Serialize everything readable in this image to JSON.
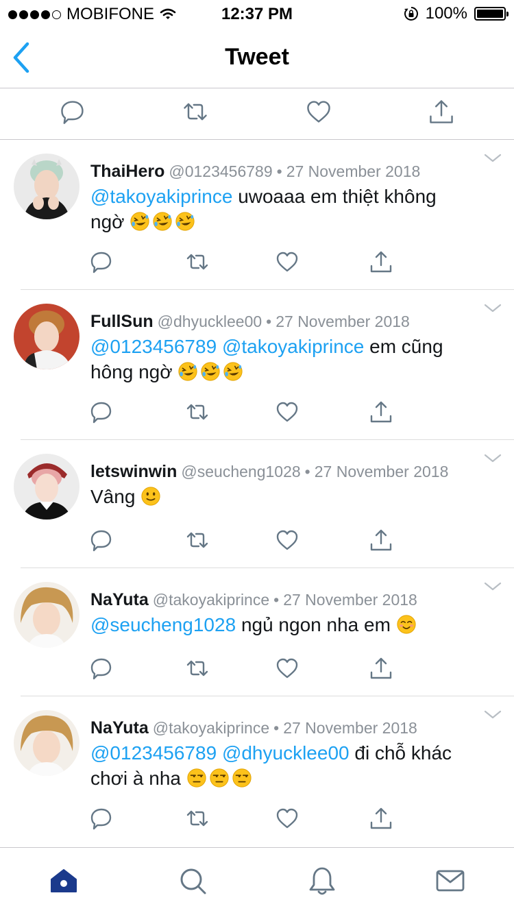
{
  "status_bar": {
    "carrier": "MOBIFONE",
    "time": "12:37 PM",
    "battery": "100%",
    "signal_bars_filled": 4,
    "signal_bars_total": 5,
    "battery_level": 1.0
  },
  "nav": {
    "title": "Tweet",
    "back_icon": "chevron-left-icon"
  },
  "main_actions": [
    "reply-icon",
    "retweet-icon",
    "like-icon",
    "share-icon"
  ],
  "replies": [
    {
      "name": "ThaiHero",
      "handle": "@0123456789",
      "separator": "•",
      "date": "27 November 2018",
      "line1_mentions": [
        "@takoyakiprince"
      ],
      "line1_text": "uwoaaa em thiệt không",
      "line2_text": "ngờ",
      "emoji": "rofl",
      "emoji_count": 3
    },
    {
      "name": "FullSun",
      "handle": "@dhyucklee00",
      "separator": "•",
      "date": "27 November 2018",
      "line1_mentions": [
        "@0123456789",
        "@takoyakiprince"
      ],
      "line1_text": "em cũng",
      "line2_text": "hông ngờ",
      "emoji": "rofl",
      "emoji_count": 3
    },
    {
      "name": "letswinwin",
      "handle": "@seucheng1028",
      "separator": "•",
      "date": "27 November 2018",
      "line1_mentions": [],
      "line1_text": "Vâng",
      "emoji": "slight-smile",
      "emoji_count": 1
    },
    {
      "name": "NaYuta",
      "handle": "@takoyakiprince",
      "separator": "•",
      "date": "27 November 2018",
      "line1_mentions": [
        "@seucheng1028"
      ],
      "line1_text": "ngủ ngon nha em",
      "emoji": "blush",
      "emoji_count": 1
    },
    {
      "name": "NaYuta",
      "handle": "@takoyakiprince",
      "separator": "•",
      "date": "27 November 2018",
      "line1_mentions": [
        "@0123456789",
        "@dhyucklee00"
      ],
      "line1_text": "đi chỗ khác",
      "line2_text": "chơi à nha",
      "emoji": "unamused",
      "emoji_count": 3
    }
  ],
  "tab_bar": {
    "tabs": [
      "home-icon",
      "search-icon",
      "notifications-icon",
      "messages-icon"
    ],
    "active": "home-icon"
  },
  "colors": {
    "accent": "#1da1f2",
    "tab_active": "#1b3a8c",
    "icon_gray": "#657786",
    "text": "#14171a",
    "meta": "#8a9097",
    "divider": "#dcdcdc"
  }
}
